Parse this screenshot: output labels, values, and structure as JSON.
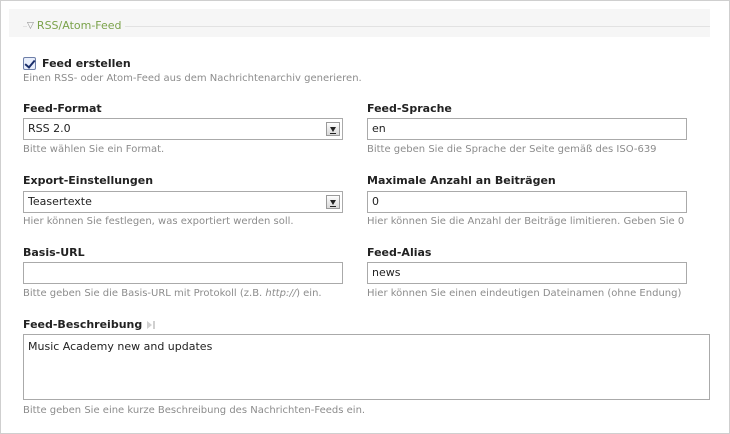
{
  "fieldset": {
    "legend": "RSS/Atom-Feed",
    "toggle_icon": "triangle-down-icon"
  },
  "create_feed": {
    "label": "Feed erstellen",
    "checked": true,
    "help": "Einen RSS- oder Atom-Feed aus dem Nachrichtenarchiv generieren."
  },
  "feed_format": {
    "label": "Feed-Format",
    "value": "RSS 2.0",
    "help": "Bitte wählen Sie ein Format."
  },
  "feed_language": {
    "label": "Feed-Sprache",
    "value": "en",
    "help": "Bitte geben Sie die Sprache der Seite gemäß des ISO-639"
  },
  "export_settings": {
    "label": "Export-Einstellungen",
    "value": "Teasertexte",
    "help": "Hier können Sie festlegen, was exportiert werden soll."
  },
  "max_items": {
    "label": "Maximale Anzahl an Beiträgen",
    "value": "0",
    "help": "Hier können Sie die Anzahl der Beiträge limitieren. Geben Sie 0"
  },
  "base_url": {
    "label": "Basis-URL",
    "value": "",
    "help_before": "Bitte geben Sie die Basis-URL mit Protokoll (z.B. ",
    "help_em": "http://",
    "help_after": ") ein."
  },
  "feed_alias": {
    "label": "Feed-Alias",
    "value": "news",
    "help": "Hier können Sie einen eindeutigen Dateinamen (ohne Endung)"
  },
  "feed_description": {
    "label": "Feed-Beschreibung",
    "value": "Music Academy new and updates",
    "help": "Bitte geben Sie eine kurze Beschreibung des Nachrichten-Feeds ein.",
    "icon": "wizard-icon"
  }
}
